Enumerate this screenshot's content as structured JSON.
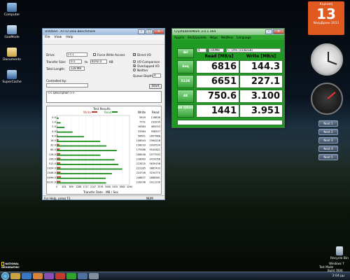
{
  "desktop": {
    "icons": [
      {
        "label": "Computer"
      },
      {
        "label": "GoaMode"
      },
      {
        "label": "Documents"
      },
      {
        "label": "SuperCache"
      }
    ],
    "bottom_left_logo": "NATIONAL GEOGRAPHIC",
    "recycle_label": "Recycle Bin",
    "win_watermark_1": "Windows 7",
    "win_watermark_2": "Test Mode",
    "win_watermark_3": "Build 7600"
  },
  "calendar": {
    "month_title": "Κυριακή",
    "day": "13",
    "footer": "Νοεμβρίου 2011"
  },
  "gadget_buttons": [
    "Next 1",
    "Next 2",
    "Next 3",
    "Next 4",
    "Next 5"
  ],
  "atto": {
    "title": "Untitled - ATTO Disk Benchmark",
    "menu": [
      "File",
      "View",
      "Help"
    ],
    "drive_label": "Drive:",
    "drive_value": "[-c-]",
    "force_write_label": "Force Write Access",
    "direct_io_label": "Direct I/O",
    "transfer_size_label": "Transfer Size:",
    "transfer_from": "0.5",
    "transfer_to_label": "to",
    "transfer_to": "8192.0",
    "transfer_unit": "KB",
    "total_length_label": "Total Length:",
    "total_length": "128 MB",
    "io_comparison": "I/O Comparison",
    "overlapped_io": "Overlapped I/O",
    "neither": "Neither",
    "queue_depth_label": "Queue Depth:",
    "queue_depth": "4",
    "controlled_by_label": "Controlled by:",
    "start_button": "Start",
    "description": "<< Description >>",
    "results_title": "Test Results",
    "legend_write": "Write",
    "legend_read": "Read",
    "col_write": "Write",
    "col_read": "Read",
    "x_axis_label": "Transfer Rate - MB / Sec",
    "status_text": "For Help, press F1",
    "status_right": "NUM",
    "x_ticks": [
      "0",
      "429",
      "859",
      "1288",
      "1717",
      "2147",
      "2576",
      "3006",
      "3435",
      "3865",
      "4294"
    ]
  },
  "chart_data": {
    "type": "bar",
    "title": "Test Results",
    "xlabel": "Transfer Rate - MB / Sec",
    "categories": [
      "0.5",
      "1.0",
      "2.0",
      "4.0",
      "8.0",
      "16.0",
      "32.0",
      "64.0",
      "128.0",
      "256.0",
      "512.0",
      "1024.0",
      "2048.0",
      "4096.0",
      "8192.0"
    ],
    "xlim": [
      0,
      4294
    ],
    "series": [
      {
        "name": "Write",
        "color": "#c0392b",
        "values": [
          5919,
          7751,
          16384,
          33384,
          56651,
          108044,
          156033,
          175386,
          208048,
          218063,
          213520,
          222185,
          224746,
          246637,
          228148
        ]
      },
      {
        "name": "Read",
        "color": "#1c8c1c",
        "values": [
          116836,
          233295,
          465052,
          938357,
          1607668,
          2564228,
          2929534,
          3542821,
          2577932,
          3410056,
          3639158,
          3867433,
          3254770,
          2886581,
          2911230
        ]
      }
    ]
  },
  "cdm": {
    "title": "CrystalDiskMark 3.0.1 x64",
    "menu": [
      "Αρχείο",
      "Επεξεργασία",
      "Θέμα",
      "Βοήθεια",
      "Language"
    ],
    "count": "4",
    "size": "100MB",
    "drive": "C: 19% (15/82GB)",
    "all_label": "All",
    "read_header": "Read [MB/s]",
    "write_header": "Write [MB/s]",
    "rows": [
      {
        "label": "Seq",
        "read": "6816",
        "write": "144.3"
      },
      {
        "label": "512K",
        "read": "6651",
        "write": "227.1"
      },
      {
        "label": "4K",
        "read": "750.6",
        "write": "3.100"
      },
      {
        "label": "4K QD32",
        "read": "1441",
        "write": "3.951"
      }
    ]
  },
  "clock": {
    "time": "2:04 μμ"
  }
}
